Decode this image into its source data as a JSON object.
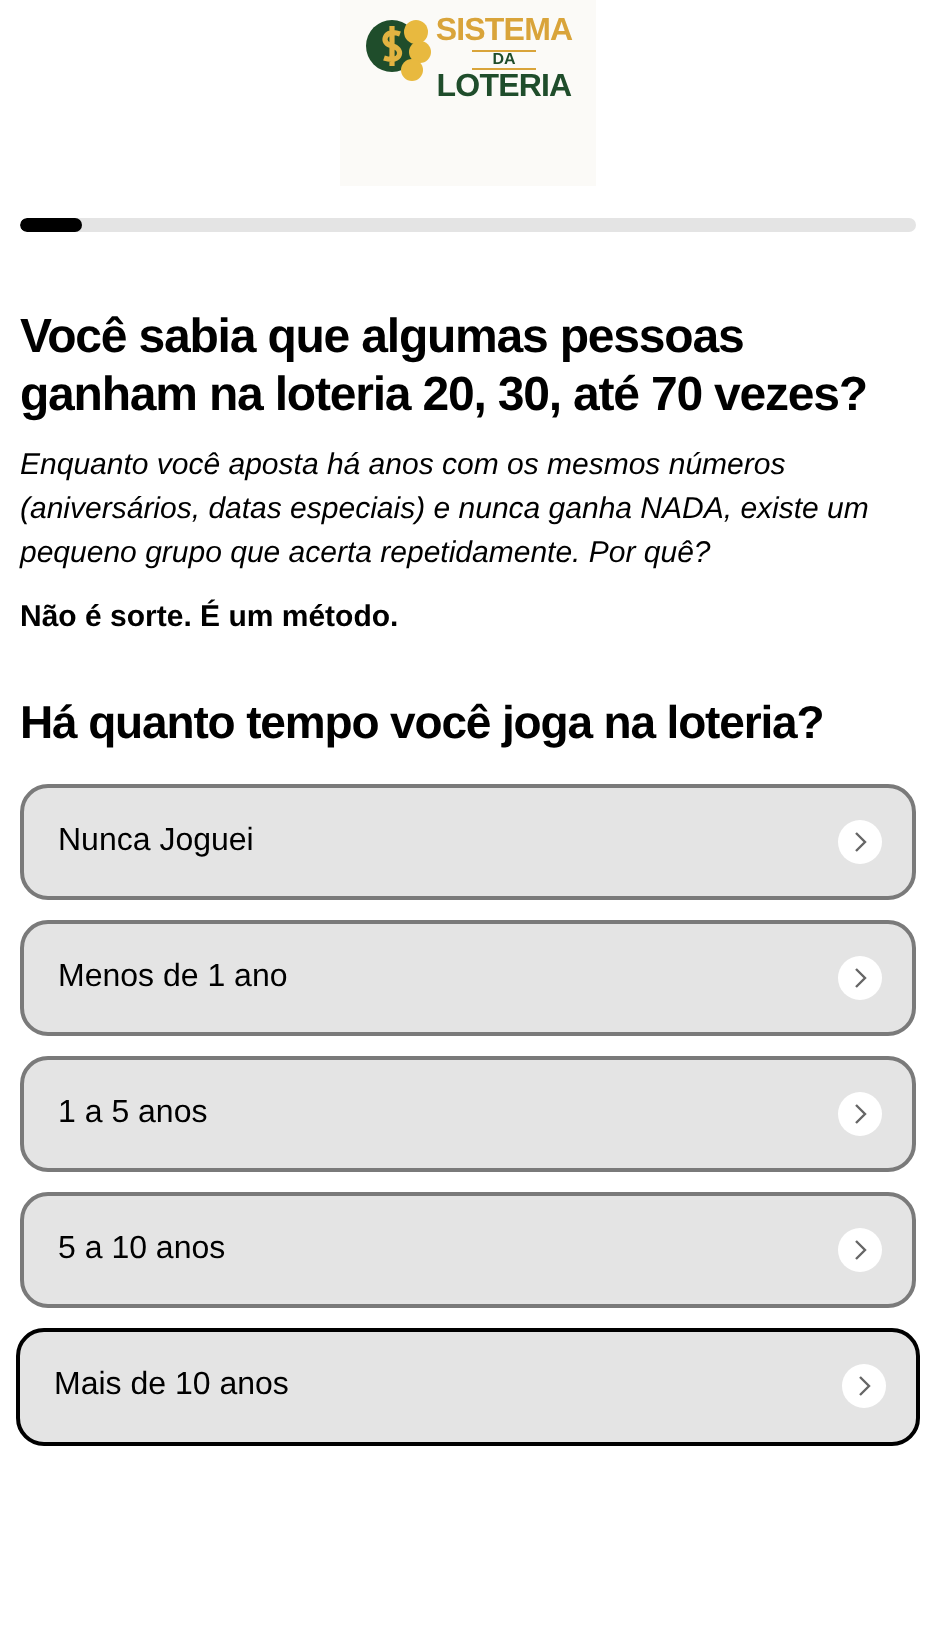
{
  "logo": {
    "line_1": "SISTEMA",
    "line_2": "DA",
    "line_3": "LOTERIA"
  },
  "progress": {
    "level": 0.07
  },
  "headline": "Você sabia que algumas pessoas ganham na loteria 20, 30, até 70 vezes?",
  "intro": "Enquanto você aposta há anos com os mesmos números (aniversários, datas especiais) e nunca ganha NADA, existe um pequeno grupo que acerta repetidamente. Por quê?",
  "tagline": "Não é sorte. É um método.",
  "question": "Há quanto tempo você joga na loteria?",
  "options": [
    {
      "label": "Nunca Joguei",
      "selected": false
    },
    {
      "label": "Menos de 1 ano",
      "selected": false
    },
    {
      "label": "1 a 5 anos",
      "selected": false
    },
    {
      "label": "5 a 10 anos",
      "selected": false
    },
    {
      "label": "Mais de 10 anos",
      "selected": true
    }
  ]
}
